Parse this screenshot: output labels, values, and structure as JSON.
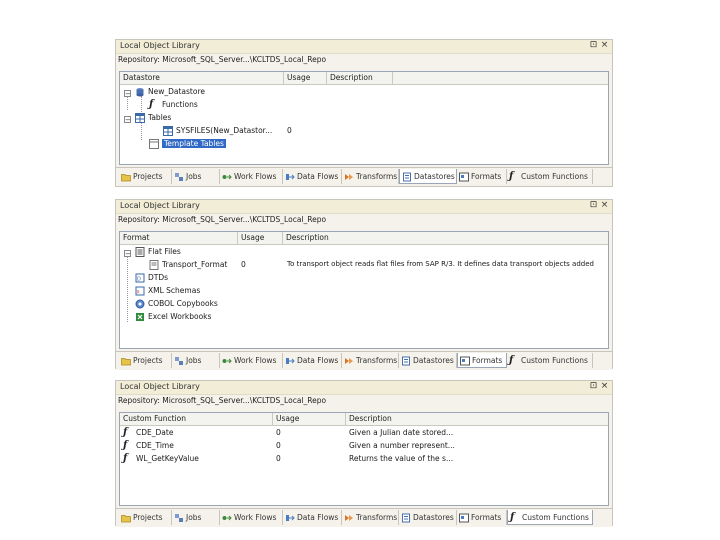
{
  "panels": [
    {
      "title": "Local Object Library",
      "repository": "Repository: Microsoft_SQL_Server...\\KCLTDS_Local_Repo",
      "columns": [
        "Datastore",
        "Usage",
        "Description"
      ],
      "rows": [
        {
          "text": "New_Datastore",
          "usage": "",
          "desc": ""
        },
        {
          "text": "Functions",
          "usage": "",
          "desc": ""
        },
        {
          "text": "Tables",
          "usage": "",
          "desc": ""
        },
        {
          "text": "SYSFILES(New_Datastor...",
          "usage": "0",
          "desc": ""
        },
        {
          "text": "Template Tables",
          "usage": "",
          "desc": ""
        }
      ],
      "active_tab": "Datastores"
    },
    {
      "title": "Local Object Library",
      "repository": "Repository: Microsoft_SQL_Server...\\KCLTDS_Local_Repo",
      "columns": [
        "Format",
        "Usage",
        "Description"
      ],
      "rows": [
        {
          "text": "Flat Files",
          "usage": "",
          "desc": ""
        },
        {
          "text": "Transport_Format",
          "usage": "0",
          "desc": "To transport object reads flat files from SAP R/3. It defines data transport objects added"
        },
        {
          "text": "DTDs",
          "usage": "",
          "desc": ""
        },
        {
          "text": "XML Schemas",
          "usage": "",
          "desc": ""
        },
        {
          "text": "COBOL Copybooks",
          "usage": "",
          "desc": ""
        },
        {
          "text": "Excel Workbooks",
          "usage": "",
          "desc": ""
        }
      ],
      "active_tab": "Formats"
    },
    {
      "title": "Local Object Library",
      "repository": "Repository: Microsoft_SQL_Server...\\KCLTDS_Local_Repo",
      "columns": [
        "Custom Function",
        "Usage",
        "Description"
      ],
      "rows": [
        {
          "text": "CDE_Date",
          "usage": "0",
          "desc": "Given a Julian date stored..."
        },
        {
          "text": "CDE_Time",
          "usage": "0",
          "desc": "Given a number represent..."
        },
        {
          "text": "WL_GetKeyValue",
          "usage": "0",
          "desc": "Returns the value of the s..."
        }
      ],
      "active_tab": "Custom Functions"
    }
  ],
  "tabs": [
    "Projects",
    "Jobs",
    "Work Flows",
    "Data Flows",
    "Transforms",
    "Datastores",
    "Formats",
    "Custom Functions"
  ],
  "title_controls": {
    "pin": "⊡",
    "close": "×"
  },
  "colors": {
    "title_bg": "#f1edd6",
    "selection": "#316ac5",
    "grid_border": "#9aa6b8"
  }
}
